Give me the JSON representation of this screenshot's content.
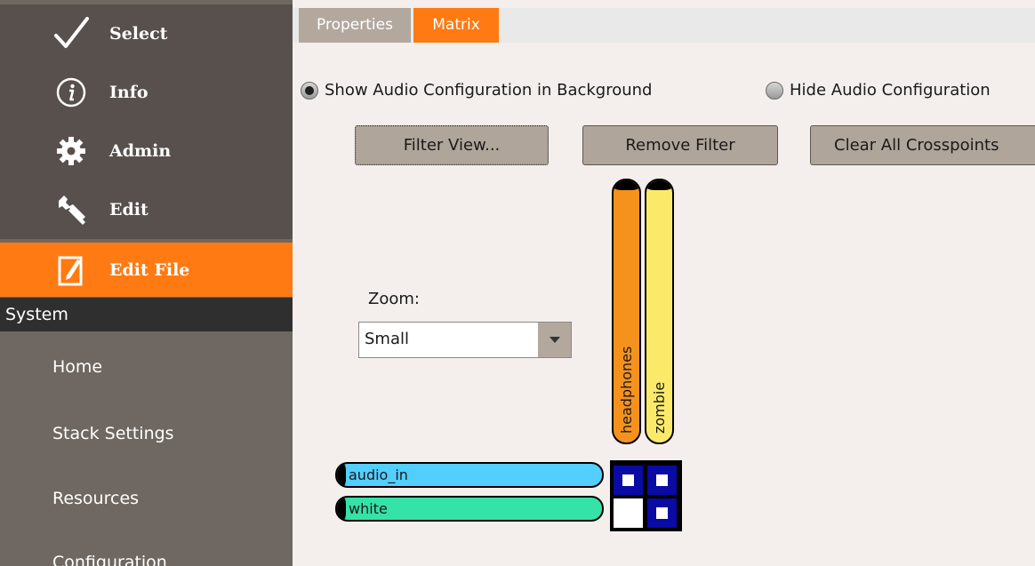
{
  "sidebar": {
    "nav_items": [
      {
        "label": "Select",
        "icon": "checkmark-icon"
      },
      {
        "label": "Info",
        "icon": "info-icon"
      },
      {
        "label": "Admin",
        "icon": "gear-icon"
      },
      {
        "label": "Edit",
        "icon": "wrench-icon"
      },
      {
        "label": "Edit File",
        "icon": "edit-file-icon",
        "active": true
      }
    ],
    "section_title": "System",
    "sub_items": [
      {
        "label": "Home"
      },
      {
        "label": "Stack Settings"
      },
      {
        "label": "Resources"
      },
      {
        "label": "Configuration"
      }
    ]
  },
  "tabs": [
    {
      "label": "Properties",
      "active": false
    },
    {
      "label": "Matrix",
      "active": true
    }
  ],
  "background_options": [
    {
      "label": "Show Audio Configuration in Background",
      "selected": true
    },
    {
      "label": "Hide Audio Configuration",
      "selected": false
    }
  ],
  "toolbar": {
    "filter_label": "Filter View...",
    "remove_filter_label": "Remove Filter",
    "clear_label": "Clear All Crosspoints"
  },
  "zoom": {
    "label": "Zoom:",
    "value": "Small",
    "arrow_icon": "chevron-down-icon"
  },
  "matrix": {
    "columns": [
      {
        "label": "headphones",
        "color": "#f5921e"
      },
      {
        "label": "zombie",
        "color": "#fbea6a"
      }
    ],
    "rows": [
      {
        "label": "audio_in",
        "color": "#52ceff"
      },
      {
        "label": "white",
        "color": "#35e2a8"
      }
    ],
    "crosspoints": [
      [
        true,
        true
      ],
      [
        false,
        true
      ]
    ]
  },
  "colors": {
    "accent": "#ff7a12",
    "sidebar_bg": "#6f6761",
    "nav_bg": "#57504c",
    "section_bg": "#2f2f2f",
    "button_bg": "#b0a59b",
    "content_bg": "#f4efec",
    "crosspoint_on": "#0a0aa4"
  }
}
